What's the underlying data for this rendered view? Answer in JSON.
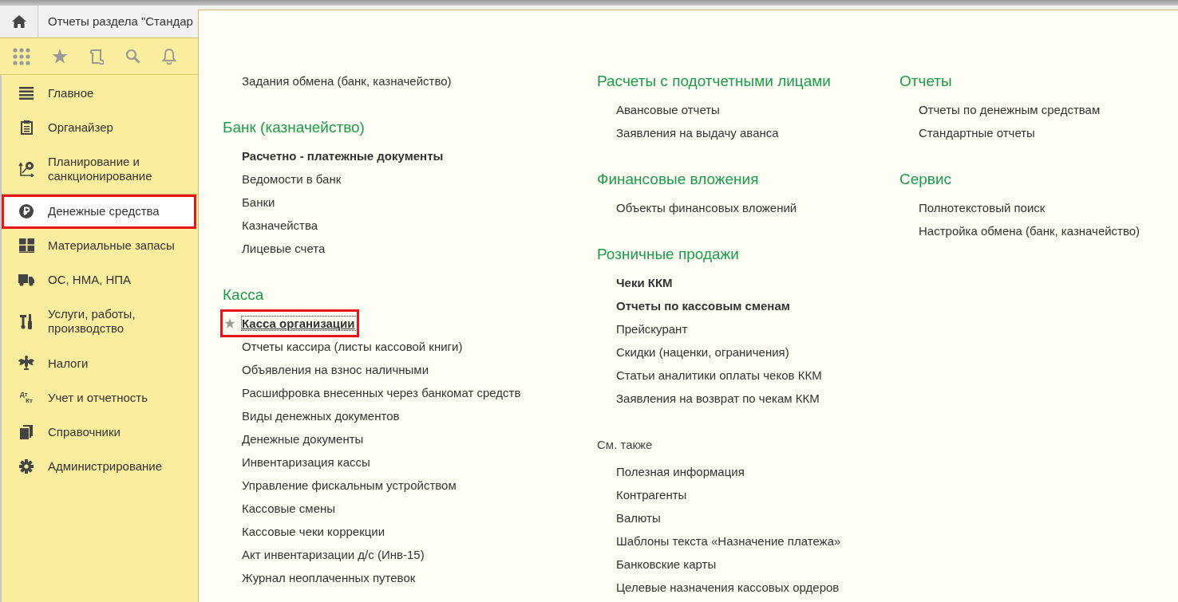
{
  "tab_bar": {
    "tab": {
      "label": "Отчеты раздела \"Стандар"
    }
  },
  "sidebar": {
    "groups": [
      [
        {
          "label": "Главное",
          "selected": false
        },
        {
          "label": "Органайзер",
          "selected": false
        },
        {
          "label": "Планирование и санкционирование",
          "selected": false
        }
      ],
      [
        {
          "label": "Денежные средства",
          "selected": true
        },
        {
          "label": "Материальные запасы",
          "selected": false
        },
        {
          "label": "ОС, НМА, НПА",
          "selected": false
        },
        {
          "label": "Услуги, работы, производство",
          "selected": false
        },
        {
          "label": "Налоги",
          "selected": false
        },
        {
          "label": "Учет и отчетность",
          "selected": false,
          "icon_text": [
            "Дт",
            "Кт"
          ]
        },
        {
          "label": "Справочники",
          "selected": false
        },
        {
          "label": "Администрирование",
          "selected": false
        }
      ]
    ]
  },
  "panel": {
    "columns": [
      {
        "groups": [
          {
            "kind": "section",
            "items": [
              {
                "label": "Задания обмена (банк, казначейство)",
                "bold": false,
                "starred": false,
                "focused": false,
                "highlighted": false
              }
            ]
          },
          {
            "kind": "section",
            "heading": "Банк (казначейство)",
            "items": [
              {
                "label": "Расчетно - платежные документы",
                "bold": true,
                "starred": false,
                "focused": false,
                "highlighted": false
              },
              {
                "label": "Ведомости в банк",
                "bold": false,
                "starred": false,
                "focused": false,
                "highlighted": false
              },
              {
                "label": "Банки",
                "bold": false,
                "starred": false,
                "focused": false,
                "highlighted": false
              },
              {
                "label": "Казначейства",
                "bold": false,
                "starred": false,
                "focused": false,
                "highlighted": false
              },
              {
                "label": "Лицевые счета",
                "bold": false,
                "starred": false,
                "focused": false,
                "highlighted": false
              }
            ]
          },
          {
            "kind": "section",
            "heading": "Касса",
            "items": [
              {
                "label": "Касса организации",
                "bold": true,
                "starred": true,
                "focused": true,
                "highlighted": true
              },
              {
                "label": "Отчеты кассира (листы кассовой книги)",
                "bold": false,
                "starred": false,
                "focused": false,
                "highlighted": false
              },
              {
                "label": "Объявления на взнос наличными",
                "bold": false,
                "starred": false,
                "focused": false,
                "highlighted": false
              },
              {
                "label": "Расшифровка внесенных через банкомат средств",
                "bold": false,
                "starred": false,
                "focused": false,
                "highlighted": false
              },
              {
                "label": "Виды денежных документов",
                "bold": false,
                "starred": false,
                "focused": false,
                "highlighted": false
              },
              {
                "label": "Денежные документы",
                "bold": false,
                "starred": false,
                "focused": false,
                "highlighted": false
              },
              {
                "label": "Инвентаризация кассы",
                "bold": false,
                "starred": false,
                "focused": false,
                "highlighted": false
              },
              {
                "label": "Управление фискальным устройством",
                "bold": false,
                "starred": false,
                "focused": false,
                "highlighted": false
              },
              {
                "label": "Кассовые смены",
                "bold": false,
                "starred": false,
                "focused": false,
                "highlighted": false
              },
              {
                "label": "Кассовые чеки коррекции",
                "bold": false,
                "starred": false,
                "focused": false,
                "highlighted": false
              },
              {
                "label": "Акт инвентаризации д/с (Инв-15)",
                "bold": false,
                "starred": false,
                "focused": false,
                "highlighted": false
              },
              {
                "label": "Журнал неоплаченных путевок",
                "bold": false,
                "starred": false,
                "focused": false,
                "highlighted": false
              }
            ]
          }
        ]
      },
      {
        "groups": [
          {
            "kind": "section",
            "heading": "Расчеты с подотчетными лицами",
            "items": [
              {
                "label": "Авансовые отчеты",
                "bold": false,
                "starred": false,
                "focused": false,
                "highlighted": false
              },
              {
                "label": "Заявления на выдачу аванса",
                "bold": false,
                "starred": false,
                "focused": false,
                "highlighted": false
              }
            ]
          },
          {
            "kind": "section",
            "heading": "Финансовые вложения",
            "items": [
              {
                "label": "Объекты финансовых вложений",
                "bold": false,
                "starred": false,
                "focused": false,
                "highlighted": false
              }
            ]
          },
          {
            "kind": "section",
            "heading": "Розничные продажи",
            "items": [
              {
                "label": "Чеки ККМ",
                "bold": true,
                "starred": false,
                "focused": false,
                "highlighted": false
              },
              {
                "label": "Отчеты по кассовым сменам",
                "bold": true,
                "starred": false,
                "focused": false,
                "highlighted": false
              },
              {
                "label": "Прейскурант",
                "bold": false,
                "starred": false,
                "focused": false,
                "highlighted": false
              },
              {
                "label": "Скидки (наценки, ограничения)",
                "bold": false,
                "starred": false,
                "focused": false,
                "highlighted": false
              },
              {
                "label": "Статьи аналитики оплаты чеков ККМ",
                "bold": false,
                "starred": false,
                "focused": false,
                "highlighted": false
              },
              {
                "label": "Заявления на возврат по чекам ККМ",
                "bold": false,
                "starred": false,
                "focused": false,
                "highlighted": false
              }
            ]
          },
          {
            "kind": "see_also",
            "heading": "См. также",
            "items": [
              {
                "label": "Полезная информация",
                "bold": false,
                "starred": false,
                "focused": false,
                "highlighted": false
              },
              {
                "label": "Контрагенты",
                "bold": false,
                "starred": false,
                "focused": false,
                "highlighted": false
              },
              {
                "label": "Валюты",
                "bold": false,
                "starred": false,
                "focused": false,
                "highlighted": false
              },
              {
                "label": "Шаблоны текста «Назначение платежа»",
                "bold": false,
                "starred": false,
                "focused": false,
                "highlighted": false
              },
              {
                "label": "Банковские карты",
                "bold": false,
                "starred": false,
                "focused": false,
                "highlighted": false
              },
              {
                "label": "Целевые назначения кассовых ордеров",
                "bold": false,
                "starred": false,
                "focused": false,
                "highlighted": false
              }
            ]
          }
        ]
      },
      {
        "groups": [
          {
            "kind": "section",
            "heading": "Отчеты",
            "items": [
              {
                "label": "Отчеты по денежным средствам",
                "bold": false,
                "starred": false,
                "focused": false,
                "highlighted": false
              },
              {
                "label": "Стандартные отчеты",
                "bold": false,
                "starred": false,
                "focused": false,
                "highlighted": false
              }
            ]
          },
          {
            "kind": "section",
            "heading": "Сервис",
            "items": [
              {
                "label": "Полнотекстовый поиск",
                "bold": false,
                "starred": false,
                "focused": false,
                "highlighted": false
              },
              {
                "label": "Настройка обмена (банк, казначейство)",
                "bold": false,
                "starred": false,
                "focused": false,
                "highlighted": false
              }
            ]
          }
        ]
      }
    ]
  }
}
